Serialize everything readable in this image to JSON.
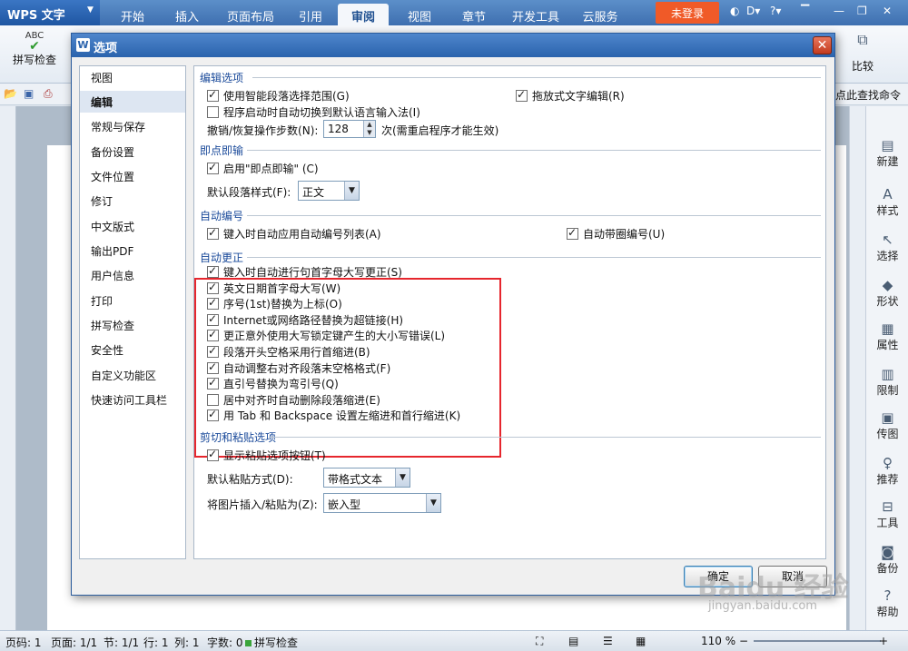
{
  "app": {
    "title": "WPS 文字",
    "ribbon_tabs": [
      "开始",
      "插入",
      "页面布局",
      "引用",
      "审阅",
      "视图",
      "章节",
      "开发工具",
      "云服务"
    ],
    "active_tab": "审阅",
    "login_label": "未登录",
    "spell_check_label": "拼写检查",
    "spell_check_icon_text": "ABC",
    "compare_label": "比较",
    "find_command_label": "点此查找命令"
  },
  "side_panel": {
    "items": [
      "新建",
      "样式",
      "选择",
      "形状",
      "属性",
      "限制",
      "传图",
      "推荐",
      "工具",
      "备份",
      "帮助"
    ]
  },
  "status_bar": {
    "page_num": "页码: 1",
    "pages": "页面: 1/1",
    "section": "节: 1/1",
    "row": "行: 1",
    "col": "列: 1",
    "word_count": "字数: 0",
    "spell_check": "拼写检查",
    "zoom": "110 %"
  },
  "dialog": {
    "title": "选项",
    "nav_items": [
      "视图",
      "编辑",
      "常规与保存",
      "备份设置",
      "文件位置",
      "修订",
      "中文版式",
      "输出PDF",
      "用户信息",
      "打印",
      "拼写检查",
      "安全性",
      "自定义功能区",
      "快速访问工具栏"
    ],
    "selected_nav": "编辑",
    "sections": {
      "edit": {
        "title": "编辑选项",
        "smart_select": "使用智能段落选择范围(G)",
        "auto_ime": "程序启动时自动切换到默认语言输入法(I)",
        "drag_edit": "拖放式文字编辑(R)",
        "undo_steps_label": "撤销/恢复操作步数(N):",
        "undo_steps_value": "128",
        "undo_steps_note": "次(需重启程序才能生效)"
      },
      "click_type": {
        "title": "即点即输",
        "enable": "启用\"即点即输\" (C)",
        "default_style_label": "默认段落样式(F):",
        "default_style_value": "正文"
      },
      "auto_number": {
        "title": "自动编号",
        "auto_list": "键入时自动应用自动编号列表(A)",
        "auto_circle": "自动带圈编号(U)"
      },
      "autocorrect": {
        "title": "自动更正",
        "items": [
          {
            "label": "键入时自动进行句首字母大写更正(S)",
            "checked": true
          },
          {
            "label": "英文日期首字母大写(W)",
            "checked": true
          },
          {
            "label": "序号(1st)替换为上标(O)",
            "checked": true
          },
          {
            "label": "Internet或网络路径替换为超链接(H)",
            "checked": true
          },
          {
            "label": "更正意外使用大写锁定键产生的大小写错误(L)",
            "checked": true
          },
          {
            "label": "段落开头空格采用行首缩进(B)",
            "checked": true
          },
          {
            "label": "自动调整右对齐段落末空格格式(F)",
            "checked": true
          },
          {
            "label": "直引号替换为弯引号(Q)",
            "checked": true
          },
          {
            "label": "居中对齐时自动删除段落缩进(E)",
            "checked": false
          },
          {
            "label": "用 Tab 和 Backspace 设置左缩进和首行缩进(K)",
            "checked": true
          }
        ]
      },
      "paste": {
        "title": "剪切和粘贴选项",
        "show_button": "显示粘贴选项按钮(T)",
        "default_paste_label": "默认粘贴方式(D):",
        "default_paste_value": "带格式文本",
        "image_paste_label": "将图片插入/粘贴为(Z):",
        "image_paste_value": "嵌入型"
      }
    },
    "ok_label": "确定",
    "cancel_label": "取消"
  },
  "watermark": {
    "text": "Baidu 经验",
    "url": "jingyan.baidu.com"
  }
}
